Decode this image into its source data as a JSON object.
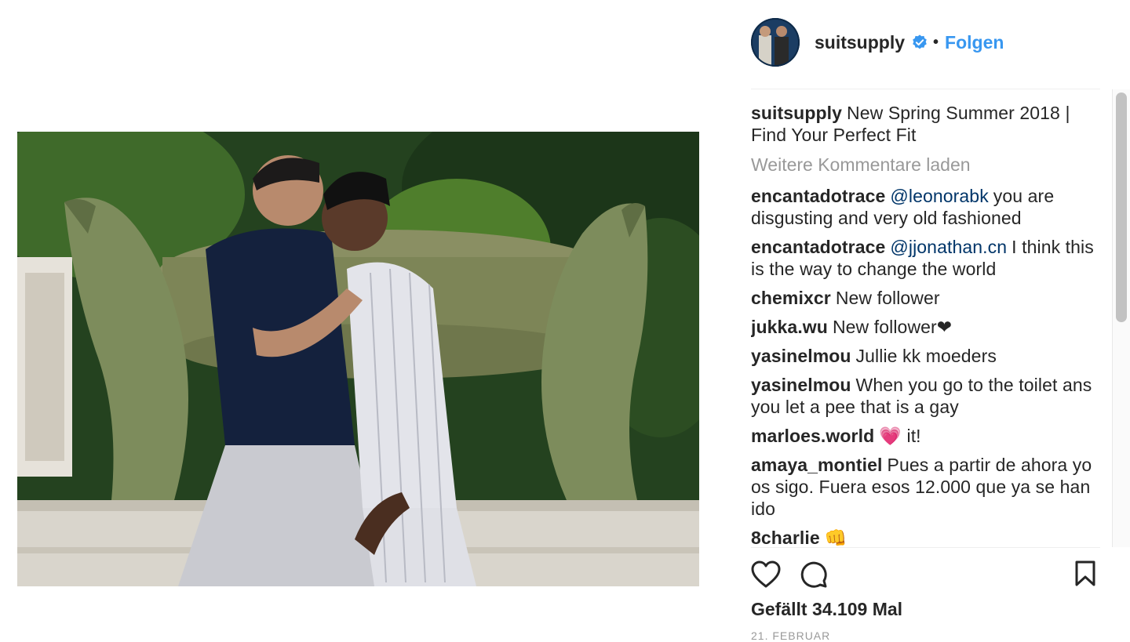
{
  "post": {
    "photo_alt": "suitsupply photo",
    "colors": {
      "link": "#3897f0",
      "mention": "#003569",
      "muted": "#999999",
      "text": "#262626"
    }
  },
  "header": {
    "username": "suitsupply",
    "verified_icon": "verified-badge-icon",
    "separator": "•",
    "follow_label": "Folgen"
  },
  "caption": {
    "username": "suitsupply",
    "text": "New Spring Summer 2018 | Find Your Perfect Fit"
  },
  "load_more_label": "Weitere Kommentare laden",
  "comments": [
    {
      "username": "encantadotrace",
      "mention": "@leonorabk",
      "text": "you are disgusting and very old fashioned"
    },
    {
      "username": "encantadotrace",
      "mention": "@jjonathan.cn",
      "text": "I think this is the way to change the world"
    },
    {
      "username": "chemixcr",
      "mention": "",
      "text": "New follower"
    },
    {
      "username": "jukka.wu",
      "mention": "",
      "text": "New follower❤"
    },
    {
      "username": "yasinelmou",
      "mention": "",
      "text": "Jullie kk moeders"
    },
    {
      "username": "yasinelmou",
      "mention": "",
      "text": "When you go to the toilet ans you let a pee that is a gay"
    },
    {
      "username": "marloes.world",
      "mention": "",
      "text": "💗  it!"
    },
    {
      "username": "amaya_montiel",
      "mention": "",
      "text": "Pues a partir de ahora yo os sigo. Fuera esos 12.000 que ya se han ido"
    },
    {
      "username": "8charlie",
      "mention": "",
      "text": "👊"
    }
  ],
  "actions": {
    "like_icon": "heart-icon",
    "comment_icon": "comment-bubble-icon",
    "save_icon": "bookmark-icon"
  },
  "likes_text": "Gefällt 34.109 Mal",
  "date_text": "21. FEBRUAR"
}
